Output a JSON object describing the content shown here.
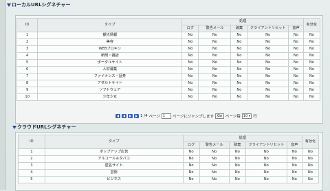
{
  "local": {
    "title": "ローカルURLシグネチャー",
    "headers": {
      "id": "ID",
      "type": "タイプ",
      "process": "処理",
      "log": "ログ",
      "warn": "警告メール",
      "block": "破棄",
      "reset": "クライアントリセット",
      "sound": "音声",
      "enable": "有効化"
    },
    "rows": [
      {
        "id": "1",
        "type": "観光情報",
        "v": [
          "No",
          "No",
          "No",
          "No",
          "No",
          "No"
        ]
      },
      {
        "id": "2",
        "type": "美容",
        "v": [
          "No",
          "No",
          "No",
          "No",
          "No",
          "No"
        ]
      },
      {
        "id": "3",
        "type": "WEBプロキシ",
        "v": [
          "No",
          "No",
          "No",
          "No",
          "No",
          "No"
        ]
      },
      {
        "id": "4",
        "type": "新聞・雑誌",
        "v": [
          "No",
          "No",
          "No",
          "No",
          "No",
          "No"
        ]
      },
      {
        "id": "5",
        "type": "ポータルサイト",
        "v": [
          "No",
          "No",
          "No",
          "No",
          "No",
          "No"
        ]
      },
      {
        "id": "6",
        "type": "人材募集",
        "v": [
          "No",
          "No",
          "No",
          "No",
          "No",
          "No"
        ]
      },
      {
        "id": "7",
        "type": "ファイナンス・証券",
        "v": [
          "No",
          "No",
          "No",
          "No",
          "No",
          "No"
        ]
      },
      {
        "id": "8",
        "type": "アダルトサイト",
        "v": [
          "No",
          "No",
          "No",
          "No",
          "No",
          "No"
        ]
      },
      {
        "id": "9",
        "type": "ソフトウェア",
        "v": [
          "No",
          "No",
          "No",
          "No",
          "No",
          "No"
        ]
      },
      {
        "id": "10",
        "type": "少年少女",
        "v": [
          "No",
          "No",
          "No",
          "No",
          "No",
          "No"
        ]
      }
    ],
    "pager": {
      "page_info": "1 /4",
      "page_label": "ページ",
      "page_value": "1",
      "jump_label": "ページにジャンプします",
      "go": "Go",
      "per_page_label": "ページ毎",
      "per_page_value": "10",
      "rows_label": "行"
    }
  },
  "cloud": {
    "title": "クラウドURLシグネチャー",
    "headers": {
      "id": "ID",
      "type": "タイプ",
      "process": "処理",
      "log": "ログ",
      "warn": "警告メール",
      "block": "破棄",
      "reset": "クライアントリセット",
      "sound": "音声",
      "enable": "有効化"
    },
    "rows": [
      {
        "id": "1",
        "type": "ポップアップ広告",
        "v": [
          "No",
          "No",
          "No",
          "No",
          "No",
          "No"
        ]
      },
      {
        "id": "2",
        "type": "アルコール＆タバコ",
        "v": [
          "No",
          "No",
          "No",
          "No",
          "No",
          "No"
        ]
      },
      {
        "id": "3",
        "type": "匿名サイト",
        "v": [
          "No",
          "No",
          "No",
          "No",
          "No",
          "No"
        ]
      },
      {
        "id": "4",
        "type": "芸術",
        "v": [
          "No",
          "No",
          "No",
          "No",
          "No",
          "No"
        ]
      },
      {
        "id": "5",
        "type": "ビジネス",
        "v": [
          "No",
          "No",
          "No",
          "No",
          "No",
          "No"
        ]
      }
    ]
  }
}
